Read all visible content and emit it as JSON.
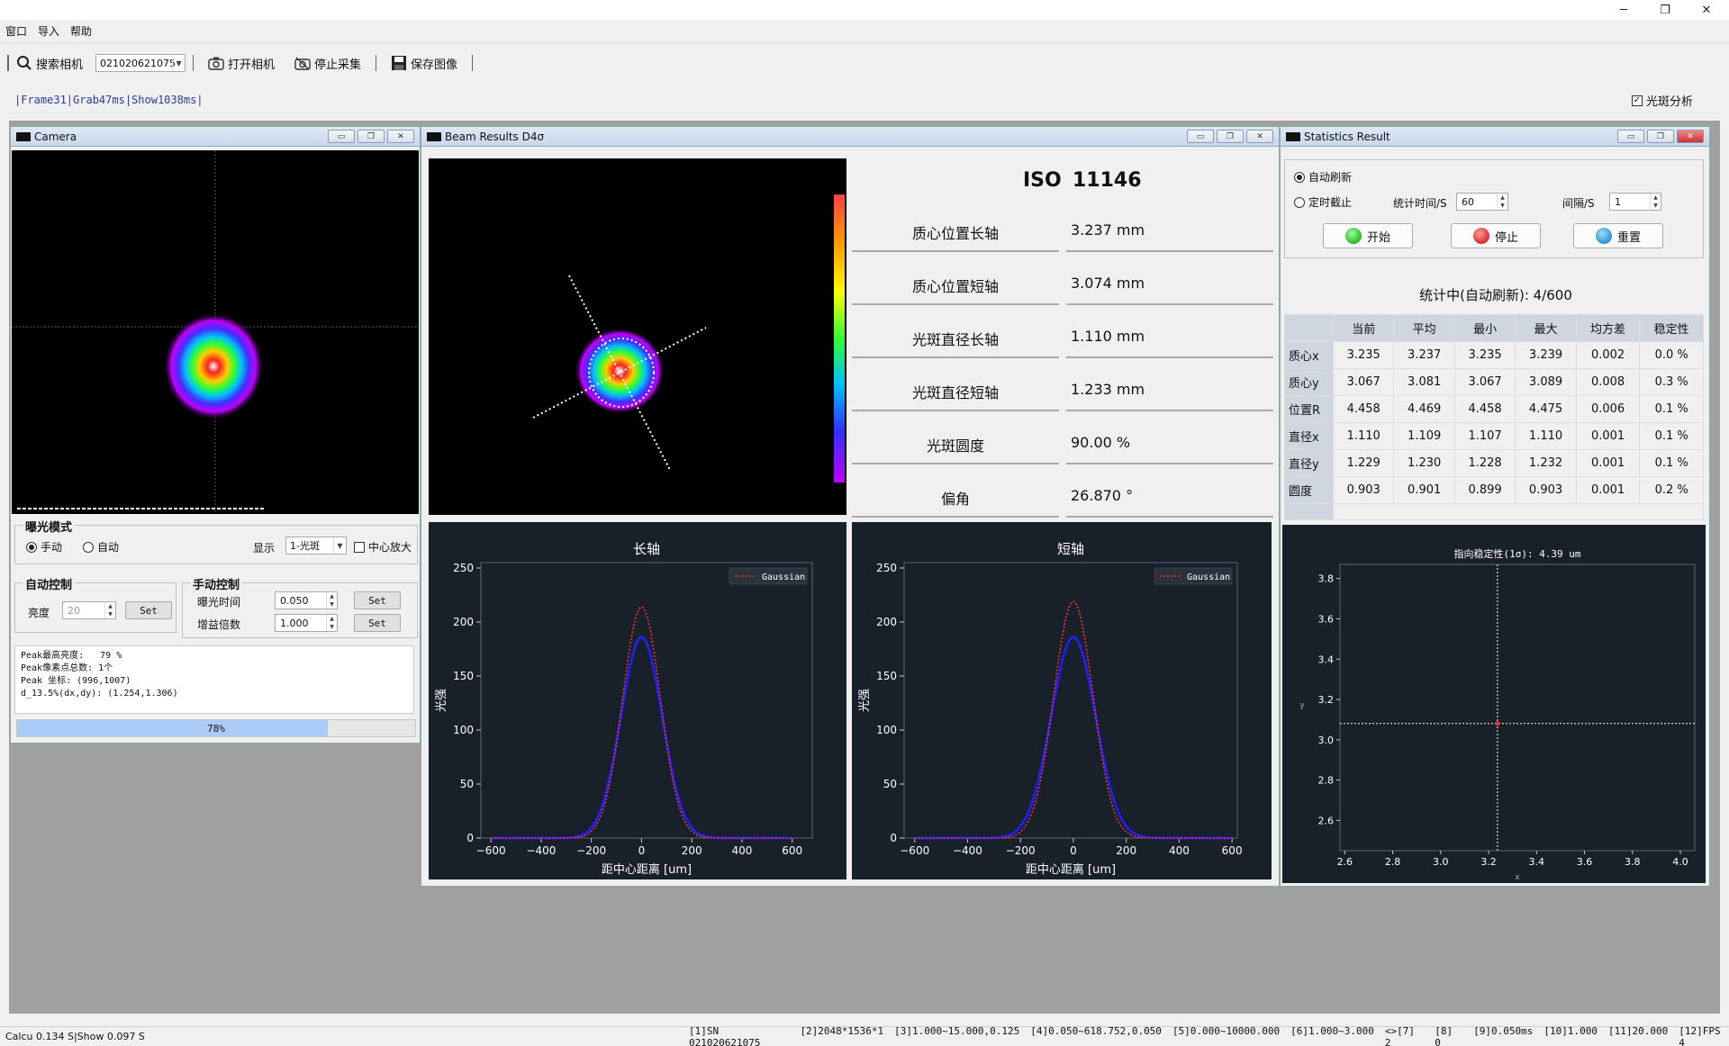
{
  "window": {
    "min": "─",
    "restore": "❐",
    "close": "✕"
  },
  "menu": [
    "窗口",
    "导入",
    "帮助"
  ],
  "toolbar": {
    "search_label": "搜索相机",
    "camera_serial": "021020621075",
    "open_label": "打开相机",
    "stop_label": "停止采集",
    "save_label": "保存图像"
  },
  "status_line": "|Frame31|Grab47ms|Show1038ms|",
  "spot_analysis": {
    "label": "光斑分析",
    "checked": true
  },
  "camera_panel": {
    "title": "Camera",
    "exposure_mode": {
      "title": "曝光模式",
      "manual": "手动",
      "auto": "自动",
      "display_label": "显示",
      "display_value": "1-光斑",
      "center_zoom": "中心放大"
    },
    "auto_control": {
      "title": "自动控制",
      "brightness_label": "亮度",
      "brightness_value": "20",
      "set": "Set"
    },
    "manual_control": {
      "title": "手动控制",
      "exposure_label": "曝光时间",
      "exposure_value": "0.050",
      "gain_label": "增益倍数",
      "gain_value": "1.000",
      "set": "Set"
    },
    "info": [
      "Peak最高亮度:   79 %",
      "Peak像素点总数: 1个",
      "Peak 坐标: (996,1007)",
      "d_13.5%(dx,dy): (1.254,1.306)"
    ],
    "progress": {
      "value": 0.78,
      "label": "78%"
    }
  },
  "beam_panel": {
    "title": "Beam Results D4σ",
    "iso_label": "ISO",
    "iso_value": "11146",
    "rows": [
      {
        "label": "质心位置长轴",
        "value": "3.237 mm"
      },
      {
        "label": "质心位置短轴",
        "value": "3.074 mm"
      },
      {
        "label": "光斑直径长轴",
        "value": "1.110 mm"
      },
      {
        "label": "光斑直径短轴",
        "value": "1.233 mm"
      },
      {
        "label": "光斑圆度",
        "value": "90.00 %"
      },
      {
        "label": "偏角",
        "value": "26.870 °"
      }
    ]
  },
  "stats_panel": {
    "title": "Statistics Result",
    "auto_refresh": "自动刷新",
    "timed_stop": "定时截止",
    "stat_time_label": "统计时间/S",
    "stat_time_value": "60",
    "interval_label": "间隔/S",
    "interval_value": "1",
    "start": "开始",
    "stop": "停止",
    "reset": "重置",
    "progress_text": "统计中(自动刷新): 4/600",
    "columns": [
      "当前",
      "平均",
      "最小",
      "最大",
      "均方差",
      "稳定性"
    ],
    "rows": [
      {
        "name": "质心x",
        "cells": [
          "3.235",
          "3.237",
          "3.235",
          "3.239",
          "0.002",
          "0.0 %"
        ]
      },
      {
        "name": "质心y",
        "cells": [
          "3.067",
          "3.081",
          "3.067",
          "3.089",
          "0.008",
          "0.3 %"
        ]
      },
      {
        "name": "位置R",
        "cells": [
          "4.458",
          "4.469",
          "4.458",
          "4.475",
          "0.006",
          "0.1 %"
        ]
      },
      {
        "name": "直径x",
        "cells": [
          "1.110",
          "1.109",
          "1.107",
          "1.110",
          "0.001",
          "0.1 %"
        ]
      },
      {
        "name": "直径y",
        "cells": [
          "1.229",
          "1.230",
          "1.228",
          "1.232",
          "0.001",
          "0.1 %"
        ]
      },
      {
        "name": "圆度",
        "cells": [
          "0.903",
          "0.901",
          "0.899",
          "0.903",
          "0.001",
          "0.2 %"
        ]
      }
    ]
  },
  "chart_data": [
    {
      "type": "line",
      "title": "长轴",
      "xlabel": "距中心距离 [um]",
      "ylabel": "光强",
      "xlim": [
        -640,
        680
      ],
      "ylim": [
        0,
        255
      ],
      "xticks": [
        -600,
        -400,
        -200,
        0,
        200,
        400,
        600
      ],
      "yticks": [
        0,
        50,
        100,
        150,
        200,
        250
      ],
      "legend": {
        "label": "Gaussian",
        "position": "top-right"
      },
      "series": [
        {
          "name": "Gaussian",
          "color": "#ff3030",
          "style": "dotted",
          "amplitude": 214,
          "center": 0,
          "sigma": 75
        },
        {
          "color": "#2020ff",
          "style": "solid",
          "amplitude": 186,
          "center": 0,
          "sigma": 82
        }
      ]
    },
    {
      "type": "line",
      "title": "短轴",
      "xlabel": "距中心距离 [um]",
      "ylabel": "光强",
      "xlim": [
        -640,
        620
      ],
      "ylim": [
        0,
        255
      ],
      "xticks": [
        -600,
        -400,
        -200,
        0,
        200,
        400,
        600
      ],
      "yticks": [
        0,
        50,
        100,
        150,
        200,
        250
      ],
      "legend": {
        "label": "Gaussian",
        "position": "top-right"
      },
      "series": [
        {
          "name": "Gaussian",
          "color": "#ff3030",
          "style": "dotted",
          "amplitude": 219,
          "center": 0,
          "sigma": 74
        },
        {
          "color": "#2020ff",
          "style": "solid",
          "amplitude": 186,
          "center": 0,
          "sigma": 84
        }
      ]
    },
    {
      "type": "scatter",
      "title": "指向稳定性(1σ): 4.39 um",
      "xlabel": "x",
      "ylabel": "y",
      "xlim": [
        2.58,
        4.06
      ],
      "ylim": [
        2.45,
        3.87
      ],
      "xticks": [
        "2.6",
        "2.8",
        "3.0",
        "3.2",
        "3.4",
        "3.6",
        "3.8",
        "4.0"
      ],
      "yticks": [
        "2.6",
        "2.8",
        "3.0",
        "3.2",
        "3.4",
        "3.6",
        "3.8"
      ],
      "points": [
        {
          "x": 3.237,
          "y": 3.081
        }
      ],
      "crosshair": {
        "x": 3.237,
        "y": 3.081
      }
    }
  ],
  "status_bar": {
    "left": "Calcu 0.134 S|Show 0.097 S",
    "items": [
      "[1]SN 021020621075",
      "[2]2048*1536*1",
      "[3]1.000~15.000,0.125",
      "[4]0.050~618.752,0.050",
      "[5]0.000~10000.000",
      "[6]1.000~3.000",
      "<>[7] 2",
      "[8] 0",
      "[9]0.050ms",
      "[10]1.000",
      "[11]20.000",
      "[12]FPS 4"
    ]
  }
}
